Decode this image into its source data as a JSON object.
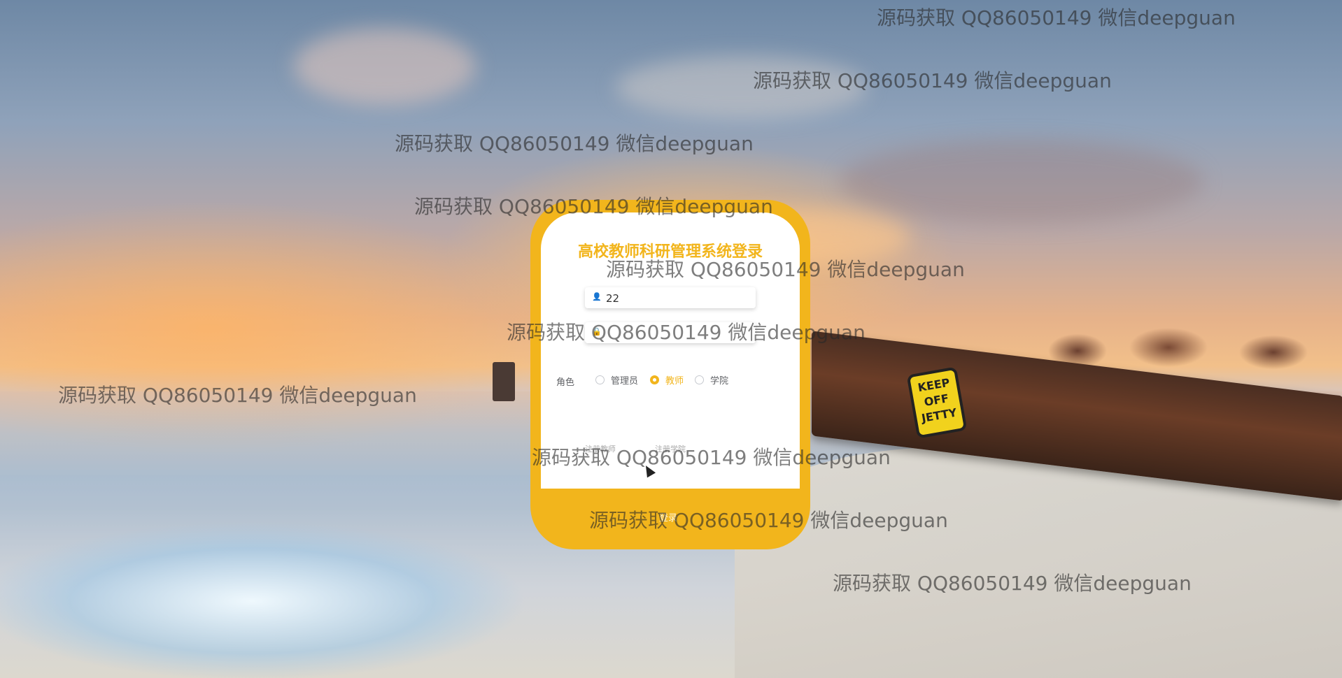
{
  "page": {
    "title": "高校教师科研管理系统登录"
  },
  "login": {
    "username_value": "22",
    "password_value": "",
    "role_label": "角色",
    "roles": [
      "管理员",
      "教师",
      "学院"
    ],
    "selected_role": "教师",
    "register_teacher_label": "注册教师",
    "register_college_label": "注册学院",
    "login_button_label": "登录",
    "accent_color": "#f2b51c"
  },
  "background": {
    "sign_text": "KEEP OFF JETTY"
  },
  "watermarks": [
    "源码获取 QQ86050149 微信deepguan",
    "源码获取 QQ86050149 微信deepguan",
    "源码获取 QQ86050149 微信deepguan",
    "源码获取 QQ86050149 微信deepguan",
    "源码获取 QQ86050149 微信deepguan",
    "源码获取 QQ86050149 微信deepguan",
    "源码获取 QQ86050149 微信deepguan",
    "源码获取 QQ86050149 微信deepguan",
    "源码获取 QQ86050149 微信deepguan",
    "源码获取 QQ86050149 微信deepguan"
  ]
}
